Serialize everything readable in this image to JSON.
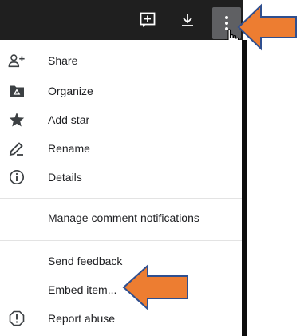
{
  "colors": {
    "topbar": "#1f1f1f",
    "more_button_bg": "#5f6063",
    "menu_text": "#202124",
    "icon": "#3c4043",
    "divider": "#e3e3e3",
    "arrow_fill": "#ed7d31",
    "arrow_stroke": "#2f4f8f"
  },
  "topbar": {
    "icons": [
      "add-comment-icon",
      "download-icon",
      "more-vert-icon"
    ]
  },
  "menu": {
    "group1": [
      {
        "label": "Share",
        "icon": "person-add-icon"
      },
      {
        "label": "Organize",
        "icon": "folder-icon"
      },
      {
        "label": "Add star",
        "icon": "star-icon"
      },
      {
        "label": "Rename",
        "icon": "pencil-icon"
      },
      {
        "label": "Details",
        "icon": "info-icon"
      }
    ],
    "group2": [
      {
        "label": "Manage comment notifications"
      }
    ],
    "group3": [
      {
        "label": "Send feedback"
      },
      {
        "label": "Embed item..."
      },
      {
        "label": "Report abuse",
        "icon": "report-icon"
      }
    ]
  }
}
